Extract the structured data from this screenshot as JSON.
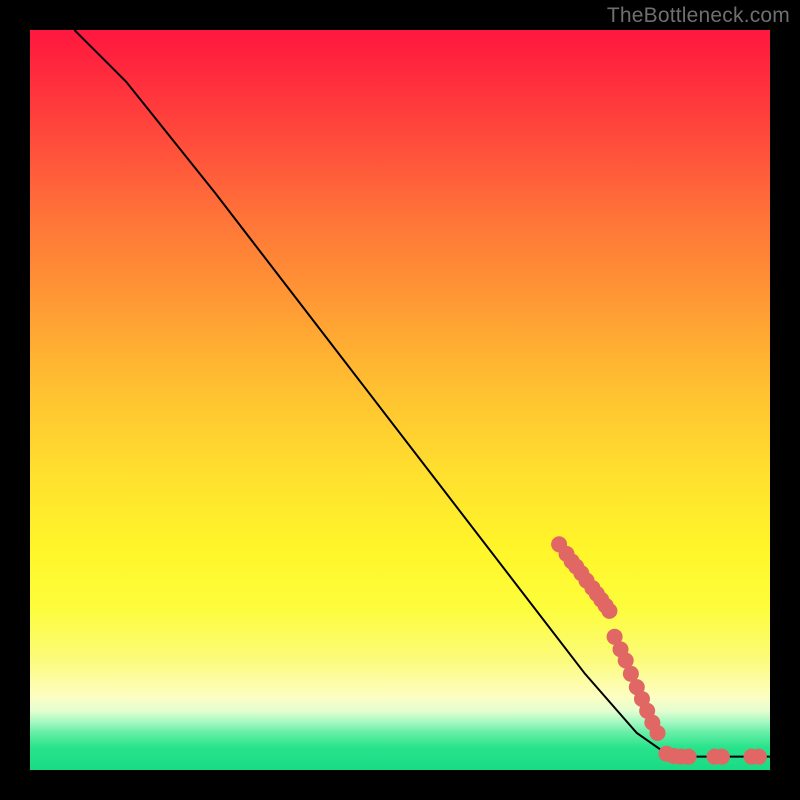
{
  "watermark": "TheBottleneck.com",
  "chart_data": {
    "type": "line",
    "title": "",
    "xlabel": "",
    "ylabel": "",
    "xlim": [
      0,
      100
    ],
    "ylim": [
      0,
      100
    ],
    "curve": [
      {
        "x": 6,
        "y": 100
      },
      {
        "x": 8,
        "y": 98
      },
      {
        "x": 10,
        "y": 96
      },
      {
        "x": 13,
        "y": 93
      },
      {
        "x": 17,
        "y": 88
      },
      {
        "x": 25,
        "y": 78
      },
      {
        "x": 35,
        "y": 65
      },
      {
        "x": 45,
        "y": 52
      },
      {
        "x": 55,
        "y": 39
      },
      {
        "x": 65,
        "y": 26
      },
      {
        "x": 75,
        "y": 13
      },
      {
        "x": 82,
        "y": 5
      },
      {
        "x": 86,
        "y": 2.2
      },
      {
        "x": 88,
        "y": 1.8
      },
      {
        "x": 92,
        "y": 1.8
      },
      {
        "x": 96,
        "y": 1.8
      },
      {
        "x": 100,
        "y": 1.8
      }
    ],
    "markers": [
      {
        "x": 71.5,
        "y": 30.5
      },
      {
        "x": 72.5,
        "y": 29.2
      },
      {
        "x": 73.2,
        "y": 28.2
      },
      {
        "x": 73.8,
        "y": 27.5
      },
      {
        "x": 74.5,
        "y": 26.6
      },
      {
        "x": 75.2,
        "y": 25.6
      },
      {
        "x": 76.0,
        "y": 24.6
      },
      {
        "x": 76.6,
        "y": 23.8
      },
      {
        "x": 77.2,
        "y": 23.0
      },
      {
        "x": 77.8,
        "y": 22.2
      },
      {
        "x": 78.3,
        "y": 21.5
      },
      {
        "x": 79.0,
        "y": 18.0
      },
      {
        "x": 79.8,
        "y": 16.3
      },
      {
        "x": 80.5,
        "y": 14.8
      },
      {
        "x": 81.2,
        "y": 13.0
      },
      {
        "x": 82.0,
        "y": 11.2
      },
      {
        "x": 82.7,
        "y": 9.6
      },
      {
        "x": 83.4,
        "y": 8.0
      },
      {
        "x": 84.1,
        "y": 6.4
      },
      {
        "x": 84.8,
        "y": 5.0
      },
      {
        "x": 86.0,
        "y": 2.2
      },
      {
        "x": 87.0,
        "y": 1.9
      },
      {
        "x": 88.0,
        "y": 1.8
      },
      {
        "x": 89.0,
        "y": 1.8
      },
      {
        "x": 92.5,
        "y": 1.8
      },
      {
        "x": 93.5,
        "y": 1.8
      },
      {
        "x": 97.5,
        "y": 1.8
      },
      {
        "x": 98.5,
        "y": 1.8
      }
    ],
    "marker_color": "#e06763",
    "curve_color": "#000000"
  }
}
